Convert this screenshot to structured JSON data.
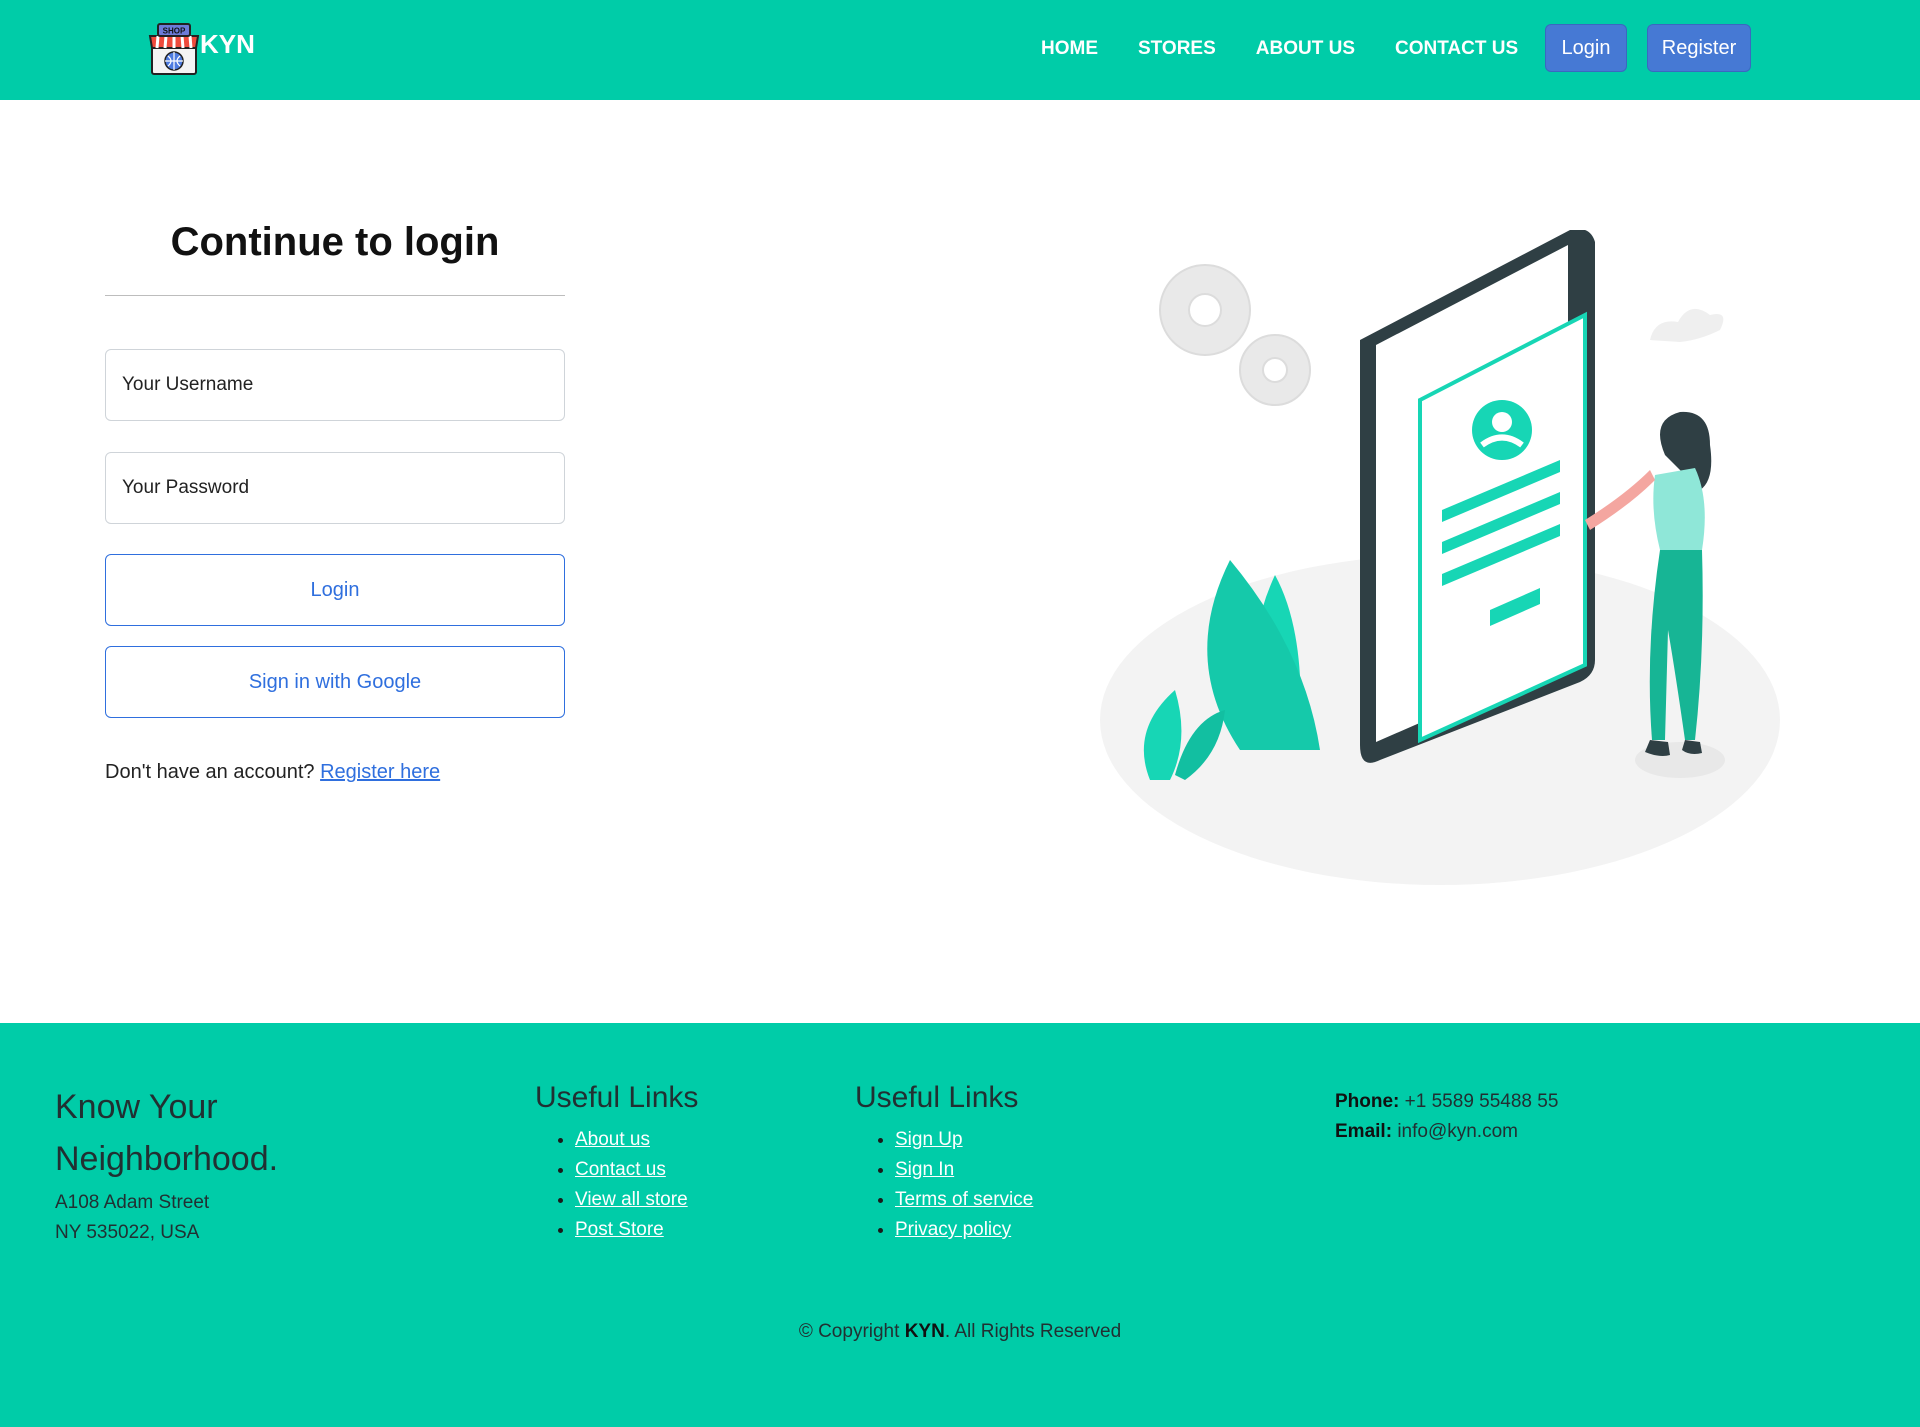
{
  "header": {
    "brand": "KYN",
    "logo_sign": "SHOP",
    "nav": [
      "HOME",
      "STORES",
      "ABOUT US",
      "CONTACT US"
    ],
    "login_label": "Login",
    "register_label": "Register"
  },
  "login": {
    "title": "Continue to login",
    "username_placeholder": "Your Username",
    "password_placeholder": "Your Password",
    "login_button": "Login",
    "google_button": "Sign in with Google",
    "signup_prompt": "Don't have an account?",
    "signup_link": "Register here"
  },
  "footer": {
    "brand": "Know Your Neighborhood.",
    "address_line1": "A108 Adam Street",
    "address_line2": "NY 535022, USA",
    "col1": {
      "title": "Useful Links",
      "links": [
        "About us",
        "Contact us",
        "View all store",
        "Post Store"
      ]
    },
    "col2": {
      "title": "Useful Links",
      "links": [
        "Sign Up",
        "Sign In",
        "Terms of service",
        "Privacy policy"
      ]
    },
    "phone_label": "Phone:",
    "phone": "+1 5589 55488 55",
    "email_label": "Email:",
    "email": "info@kyn.com",
    "copyright_prefix": "© Copyright",
    "copyright_brand": "KYN",
    "copyright_suffix": ". All Rights Reserved"
  },
  "colors": {
    "primary": "#00cca8",
    "button_blue": "#4679d4",
    "link_blue": "#2f6fde",
    "illustration_teal": "#17d6b5",
    "phone_dark": "#2f3f44"
  }
}
